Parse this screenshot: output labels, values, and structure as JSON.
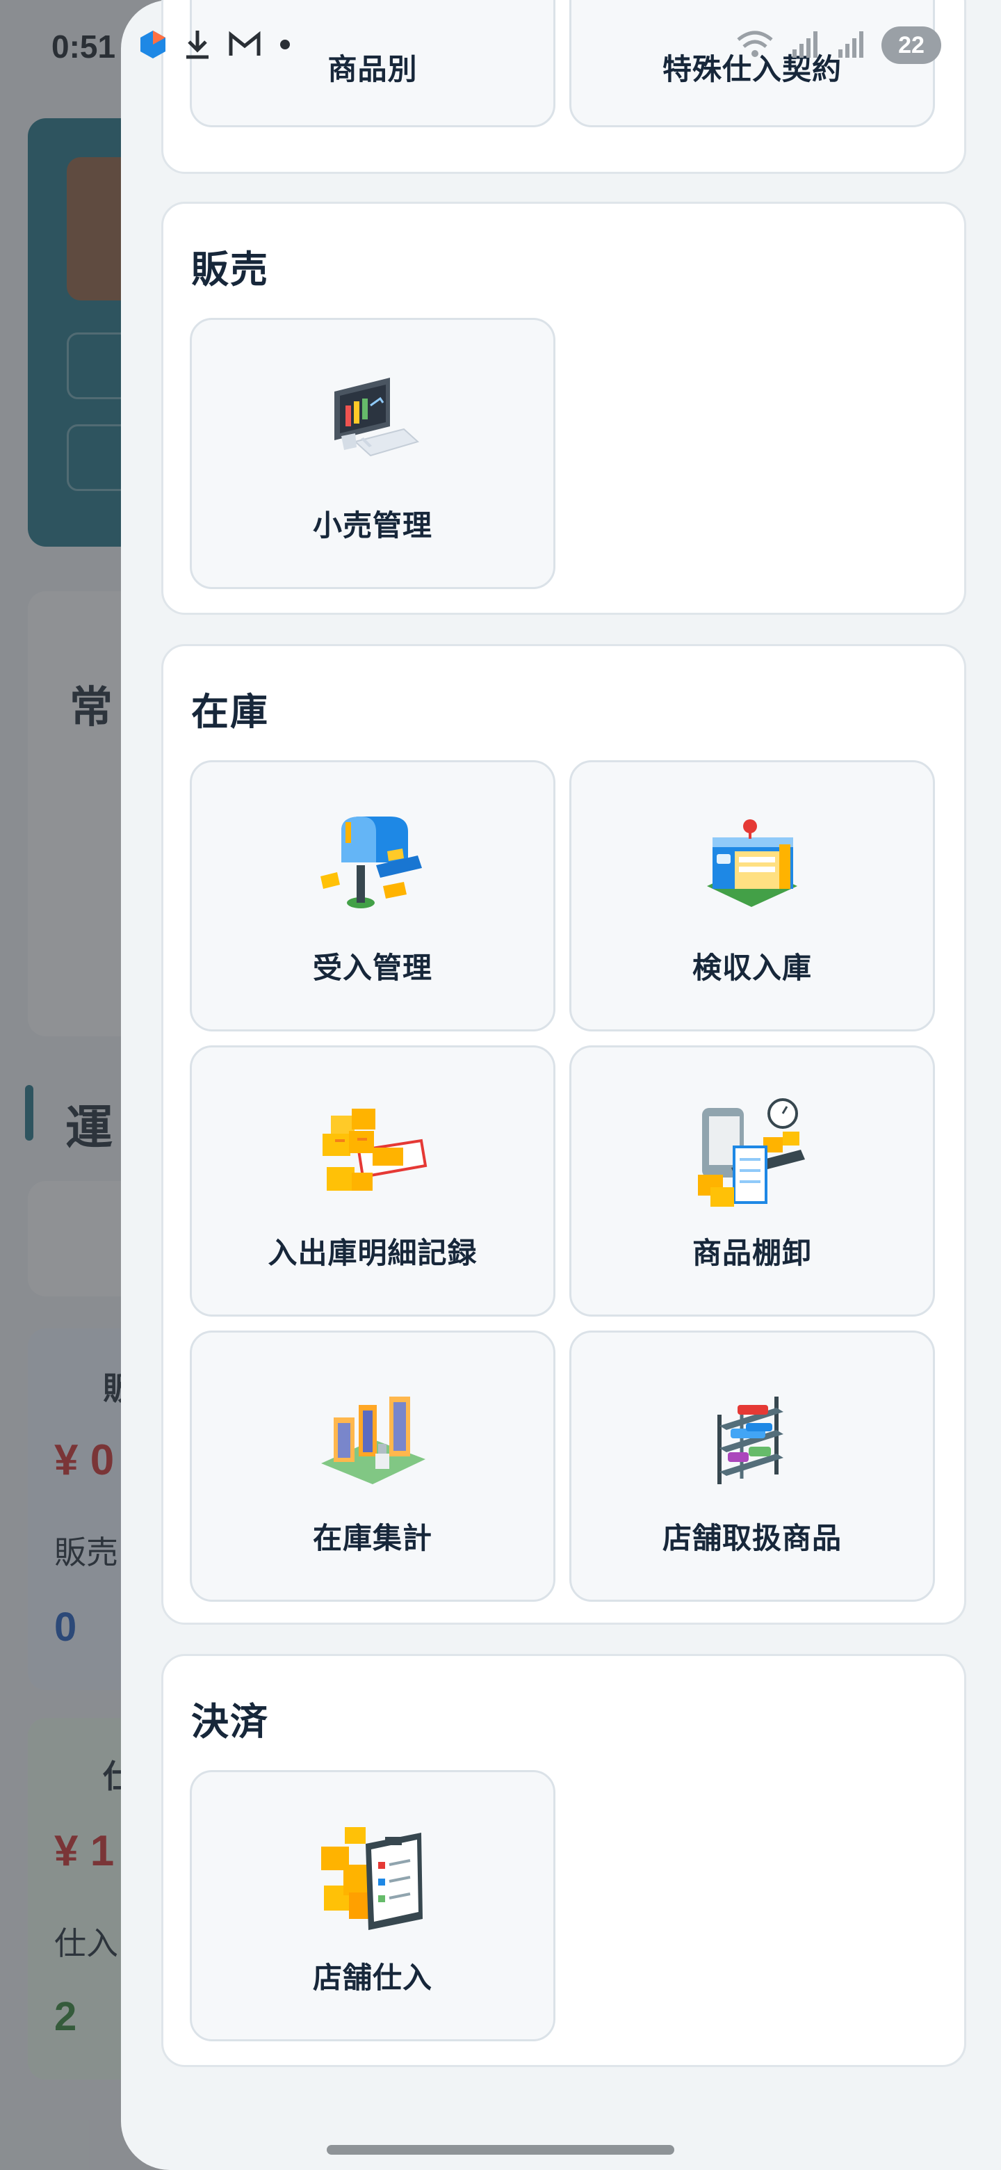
{
  "status_bar": {
    "time": "0:51",
    "battery": "22"
  },
  "background": {
    "frequent_label": "常",
    "operations_label": "運",
    "sales_label": "販",
    "sales_amount": "¥ 0",
    "sales_sub": "販売",
    "sales_count": "0",
    "purchase_label": "仕",
    "purchase_amount": "¥ 1",
    "purchase_sub": "仕入",
    "purchase_count": "2"
  },
  "top_partial": {
    "items": [
      {
        "label": "商品別",
        "icon": "red-box-icon"
      },
      {
        "label": "特殊仕入契約",
        "icon": "contract-icon"
      }
    ]
  },
  "sections": [
    {
      "title": "販売",
      "items": [
        {
          "label": "小売管理",
          "icon": "computer-terminal-icon"
        }
      ]
    },
    {
      "title": "在庫",
      "items": [
        {
          "label": "受入管理",
          "icon": "mailbox-icon"
        },
        {
          "label": "検収入庫",
          "icon": "warehouse-icon"
        },
        {
          "label": "入出庫明細記録",
          "icon": "boxes-tablet-icon"
        },
        {
          "label": "商品棚卸",
          "icon": "conveyor-icon"
        },
        {
          "label": "在庫集計",
          "icon": "warehouse-buildings-icon"
        },
        {
          "label": "店舗取扱商品",
          "icon": "shelf-icon"
        }
      ]
    },
    {
      "title": "決済",
      "items": [
        {
          "label": "店舗仕入",
          "icon": "clipboard-boxes-icon"
        }
      ]
    }
  ]
}
